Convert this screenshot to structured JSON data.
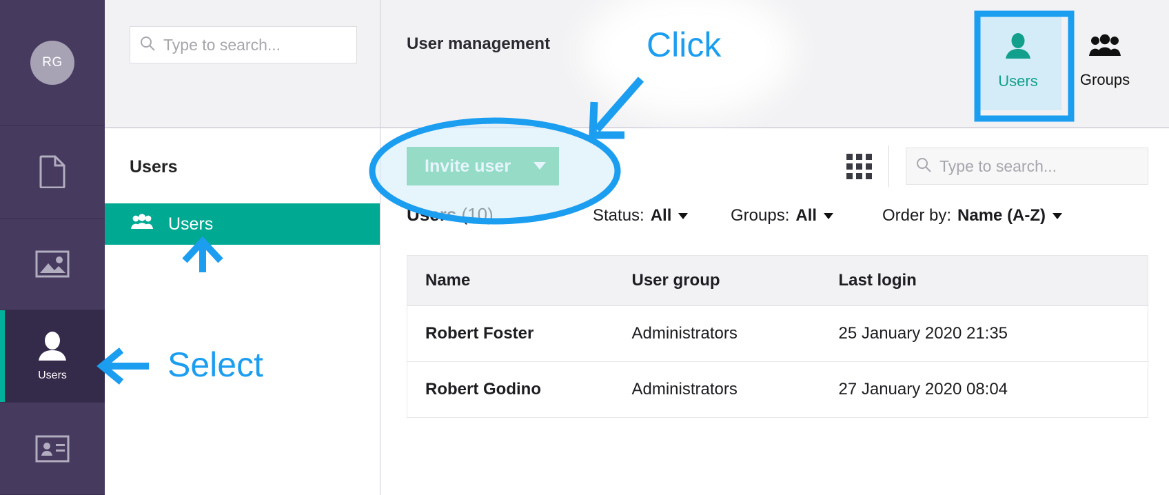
{
  "colors": {
    "rail_bg": "#463a5e",
    "rail_active_bg": "#342a4a",
    "accent_teal": "#00a991",
    "invite_green": "#2cbd72",
    "annotation_blue": "#1b9df0",
    "tab_highlight_bg": "#d4ecf7"
  },
  "rail": {
    "avatar_initials": "RG",
    "items": [
      {
        "icon": "document-icon",
        "label": ""
      },
      {
        "icon": "image-icon",
        "label": ""
      },
      {
        "icon": "user-icon",
        "label": "Users"
      },
      {
        "icon": "id-card-icon",
        "label": ""
      }
    ]
  },
  "global_search": {
    "placeholder": "Type to search...",
    "value": "",
    "icon": "search-icon"
  },
  "column2": {
    "title": "Users",
    "nav_items": [
      {
        "icon": "users-group-icon",
        "label": "Users",
        "active": true
      }
    ]
  },
  "header": {
    "title": "User management",
    "tabs": [
      {
        "label": "Users",
        "icon": "single-user-icon",
        "active": true
      },
      {
        "label": "Groups",
        "icon": "group-users-icon",
        "active": false
      }
    ]
  },
  "toolbar": {
    "invite_label": "Invite user",
    "invite_caret_icon": "chevron-down-icon",
    "grid_view_icon": "grid-view-icon",
    "search": {
      "placeholder": "Type to search...",
      "value": "",
      "icon": "search-icon"
    }
  },
  "filters": {
    "count_label": "Users",
    "count_value": "(10)",
    "status": {
      "label": "Status:",
      "value": "All",
      "caret": "caret-down-icon"
    },
    "groups": {
      "label": "Groups:",
      "value": "All",
      "caret": "caret-down-icon"
    },
    "order_by": {
      "label": "Order by:",
      "value": "Name (A-Z)",
      "caret": "caret-down-icon"
    }
  },
  "table": {
    "columns": [
      "Name",
      "User group",
      "Last login"
    ],
    "rows": [
      {
        "name": "Robert Foster",
        "user_group": "Administrators",
        "last_login": "25 January 2020 21:35"
      },
      {
        "name": "Robert Godino",
        "user_group": "Administrators",
        "last_login": "27 January 2020 08:04"
      }
    ]
  },
  "annotations": [
    {
      "text": "Click",
      "target": "invite-user-button"
    },
    {
      "text": "Select",
      "target": "sidebar-users-item"
    }
  ]
}
